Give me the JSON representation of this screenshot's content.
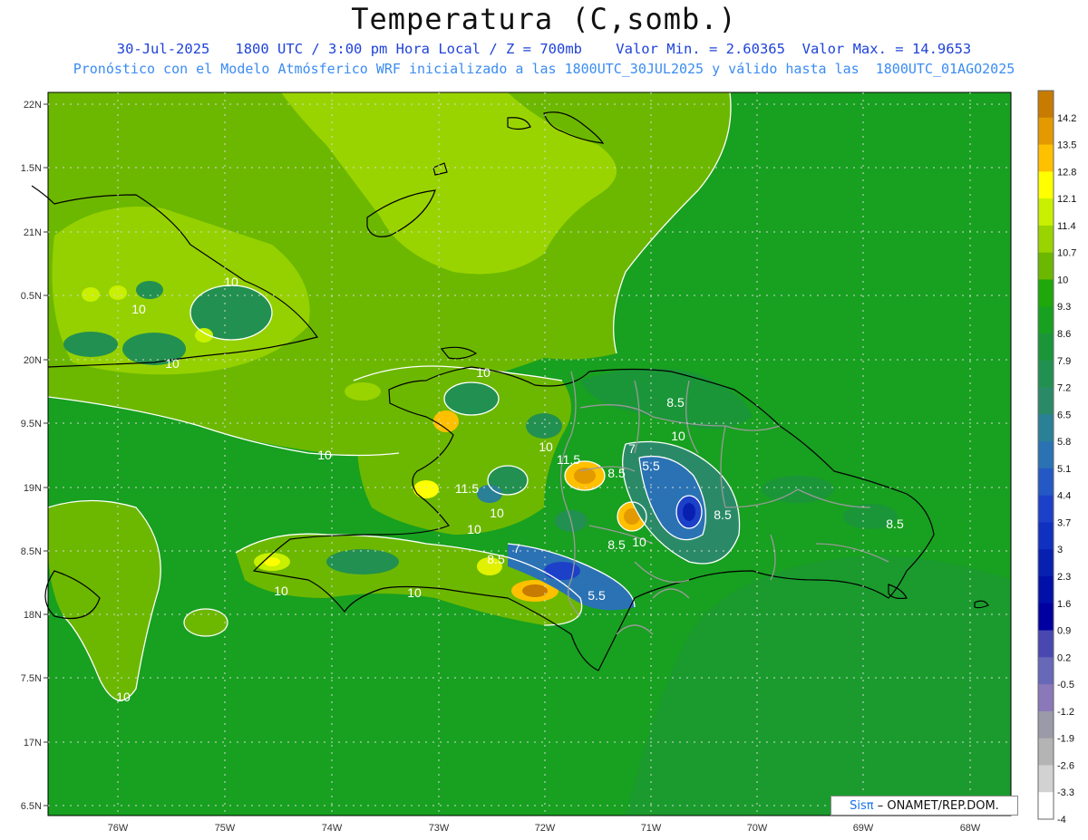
{
  "header": {
    "title": "Temperatura (C,somb.)",
    "line1": "30-Jul-2025   1800 UTC / 3:00 pm Hora Local / Z = 700mb    Valor Min. = 2.60365  Valor Max. = 14.9653",
    "line2": "Pronóstico con el Modelo Atmósferico WRF inicializado a las 1800UTC_30JUL2025 y válido hasta las  1800UTC_01AGO2025"
  },
  "axes": {
    "lat_labels": [
      "22N",
      "1.5N",
      "21N",
      "0.5N",
      "20N",
      "9.5N",
      "19N",
      "8.5N",
      "18N",
      "7.5N",
      "17N",
      "6.5N"
    ],
    "lon_labels": [
      "76W",
      "75W",
      "74W",
      "73W",
      "72W",
      "71W",
      "70W",
      "69W",
      "68W"
    ]
  },
  "colorbar": {
    "labels": [
      "14.2",
      "13.5",
      "12.8",
      "12.1",
      "11.4",
      "10.7",
      "10",
      "9.3",
      "8.6",
      "7.9",
      "7.2",
      "6.5",
      "5.8",
      "5.1",
      "4.4",
      "3.7",
      "3",
      "2.3",
      "1.6",
      "0.9",
      "0.2",
      "-0.5",
      "-1.2",
      "-1.9",
      "-2.6",
      "-3.3",
      "-4"
    ],
    "colors": [
      "#c77b00",
      "#e39a00",
      "#ffc000",
      "#ffff00",
      "#c8f000",
      "#9ad400",
      "#6cb800",
      "#1fa80a",
      "#18a020",
      "#1a9638",
      "#229050",
      "#2a8a68",
      "#2a8096",
      "#2a72b4",
      "#2458c4",
      "#1c40c8",
      "#1030c0",
      "#0820b0",
      "#0010a8",
      "#0000a0",
      "#4848b0",
      "#6868b8",
      "#8a78b8",
      "#9a9aa8",
      "#b4b4b4",
      "#d2d2d2",
      "#ffffff"
    ]
  },
  "contour_labels": [
    {
      "text": "10",
      "id": "c1"
    },
    {
      "text": "10",
      "id": "c2"
    },
    {
      "text": "10",
      "id": "c3"
    },
    {
      "text": "10",
      "id": "c4"
    },
    {
      "text": "10",
      "id": "c5"
    },
    {
      "text": "10",
      "id": "c6"
    },
    {
      "text": "10",
      "id": "c7"
    },
    {
      "text": "10",
      "id": "c8"
    },
    {
      "text": "10",
      "id": "c9"
    },
    {
      "text": "10",
      "id": "c10"
    },
    {
      "text": "10",
      "id": "c11"
    },
    {
      "text": "10",
      "id": "c12"
    },
    {
      "text": "8.5",
      "id": "c13"
    },
    {
      "text": "8.5",
      "id": "c14"
    },
    {
      "text": "8.5",
      "id": "c15"
    },
    {
      "text": "8.5",
      "id": "c16"
    },
    {
      "text": "8.5",
      "id": "c17"
    },
    {
      "text": "8.5",
      "id": "c18"
    },
    {
      "text": "5.5",
      "id": "c19"
    },
    {
      "text": "5.5",
      "id": "c20"
    },
    {
      "text": "11.5",
      "id": "c21"
    },
    {
      "text": "11.5",
      "id": "c22"
    },
    {
      "text": "7",
      "id": "c23"
    },
    {
      "text": "7",
      "id": "c24"
    },
    {
      "text": "10",
      "id": "c25"
    }
  ],
  "credit": {
    "sis": "Sisπ",
    "rest": "– ONAMET/REP.DOM."
  }
}
